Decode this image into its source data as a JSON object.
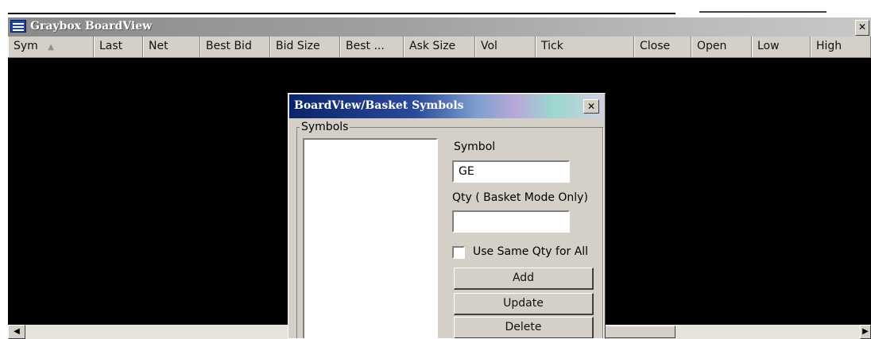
{
  "main_window": {
    "title": "Graybox BoardView",
    "close_glyph": "✕",
    "icon": "app-grid-icon",
    "columns": [
      {
        "label": "Sym",
        "sorted": true
      },
      {
        "label": "Last"
      },
      {
        "label": "Net"
      },
      {
        "label": "Best Bid"
      },
      {
        "label": "Bid Size"
      },
      {
        "label": "Best ..."
      },
      {
        "label": "Ask Size"
      },
      {
        "label": "Vol"
      },
      {
        "label": "Tick"
      },
      {
        "label": "Close"
      },
      {
        "label": "Open"
      },
      {
        "label": "Low"
      },
      {
        "label": "High"
      }
    ],
    "sort_arrow": "▲",
    "scroll_left_glyph": "◀",
    "scroll_right_glyph": "▶"
  },
  "dialog": {
    "title": "BoardView/Basket Symbols",
    "close_glyph": "✕",
    "group_label": "Symbols",
    "symbol_label": "Symbol",
    "symbol_value": "GE",
    "qty_label": "Qty ( Basket Mode Only)",
    "qty_value": "",
    "checkbox_label": "Use Same Qty for All",
    "checkbox_checked": false,
    "add_label": "Add",
    "update_label": "Update",
    "delete_label": "Delete"
  },
  "colors": {
    "grid_background": "#000000",
    "chrome": "#d4d0c8",
    "dialog_title_start": "#0a246a"
  }
}
